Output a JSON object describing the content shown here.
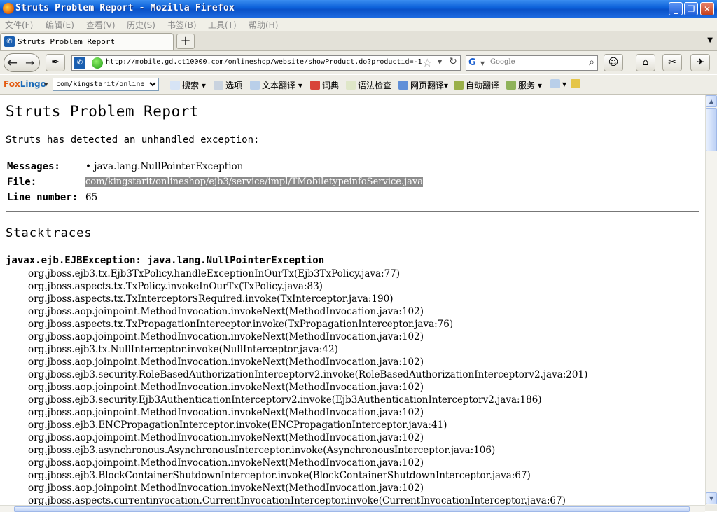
{
  "window": {
    "title": "Struts Problem Report - Mozilla Firefox",
    "minimize": "_",
    "restore": "❐",
    "close": "✕"
  },
  "menubar": {
    "items": [
      "文件(F)",
      "编辑(E)",
      "查看(V)",
      "历史(S)",
      "书签(B)",
      "工具(T)",
      "帮助(H)"
    ]
  },
  "tabs": [
    {
      "label": "Struts Problem Report",
      "active": true
    }
  ],
  "navbar": {
    "url": "http://mobile.gd.ct10000.com/onlineshop/website/showProduct.do?productid=-1",
    "search_engine": "Google",
    "search_placeholder": "Google"
  },
  "foxlingo": {
    "logo_fox": "Fox",
    "logo_lingo": "Lingo",
    "select_value": "com/kingstarit/online",
    "items": [
      "搜索",
      "选项",
      "文本翻译",
      "词典",
      "语法检查",
      "网页翻译",
      "自动翻译",
      "服务"
    ]
  },
  "report": {
    "title": "Struts Problem Report",
    "intro": "Struts has detected an unhandled exception:",
    "messages_label": "Messages:",
    "messages_value": "• java.lang.NullPointerException",
    "file_label": "File:",
    "file_value": "com/kingstarit/onlineshop/ejb3/service/impl/TMobiletypeinfoService.java",
    "line_label": "Line number:",
    "line_value": "65",
    "stacktraces_heading": "Stacktraces",
    "exception": "javax.ejb.EJBException: java.lang.NullPointerException",
    "trace": [
      "org.jboss.ejb3.tx.Ejb3TxPolicy.handleExceptionInOurTx(Ejb3TxPolicy.java:77)",
      "org.jboss.aspects.tx.TxPolicy.invokeInOurTx(TxPolicy.java:83)",
      "org.jboss.aspects.tx.TxInterceptor$Required.invoke(TxInterceptor.java:190)",
      "org.jboss.aop.joinpoint.MethodInvocation.invokeNext(MethodInvocation.java:102)",
      "org.jboss.aspects.tx.TxPropagationInterceptor.invoke(TxPropagationInterceptor.java:76)",
      "org.jboss.aop.joinpoint.MethodInvocation.invokeNext(MethodInvocation.java:102)",
      "org.jboss.ejb3.tx.NullInterceptor.invoke(NullInterceptor.java:42)",
      "org.jboss.aop.joinpoint.MethodInvocation.invokeNext(MethodInvocation.java:102)",
      "org.jboss.ejb3.security.RoleBasedAuthorizationInterceptorv2.invoke(RoleBasedAuthorizationInterceptorv2.java:201)",
      "org.jboss.aop.joinpoint.MethodInvocation.invokeNext(MethodInvocation.java:102)",
      "org.jboss.ejb3.security.Ejb3AuthenticationInterceptorv2.invoke(Ejb3AuthenticationInterceptorv2.java:186)",
      "org.jboss.aop.joinpoint.MethodInvocation.invokeNext(MethodInvocation.java:102)",
      "org.jboss.ejb3.ENCPropagationInterceptor.invoke(ENCPropagationInterceptor.java:41)",
      "org.jboss.aop.joinpoint.MethodInvocation.invokeNext(MethodInvocation.java:102)",
      "org.jboss.ejb3.asynchronous.AsynchronousInterceptor.invoke(AsynchronousInterceptor.java:106)",
      "org.jboss.aop.joinpoint.MethodInvocation.invokeNext(MethodInvocation.java:102)",
      "org.jboss.ejb3.BlockContainerShutdownInterceptor.invoke(BlockContainerShutdownInterceptor.java:67)",
      "org.jboss.aop.joinpoint.MethodInvocation.invokeNext(MethodInvocation.java:102)",
      "org.jboss.aspects.currentinvocation.CurrentInvocationInterceptor.invoke(CurrentInvocationInterceptor.java:67)"
    ]
  },
  "colors": {
    "titlebar": "#0a5fd8",
    "chrome": "#eeede6",
    "selection": "#8c8c8c"
  }
}
